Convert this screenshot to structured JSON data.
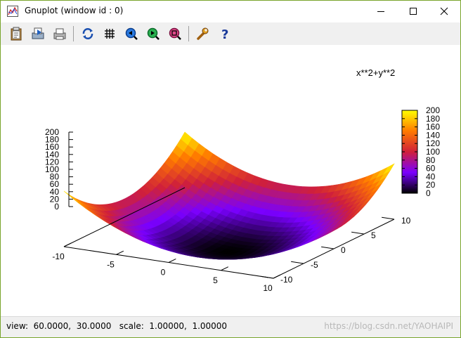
{
  "window": {
    "title": "Gnuplot (window id : 0)"
  },
  "toolbar": {
    "buttons": [
      {
        "name": "copy-clipboard-icon"
      },
      {
        "name": "print-setup-icon"
      },
      {
        "name": "print-icon"
      },
      {
        "name": "replot-icon"
      },
      {
        "name": "grid-icon"
      },
      {
        "name": "zoom-previous-icon"
      },
      {
        "name": "zoom-next-icon"
      },
      {
        "name": "unzoom-icon"
      },
      {
        "name": "options-wrench-icon"
      },
      {
        "name": "help-icon"
      }
    ]
  },
  "plot": {
    "title": "x**2+y**2",
    "zlabels": [
      "200",
      "180",
      "160",
      "140",
      "120",
      "100",
      "80",
      "60",
      "40",
      "20",
      "0"
    ],
    "cblabels": [
      "200",
      "180",
      "160",
      "140",
      "120",
      "100",
      "80",
      "60",
      "40",
      "20",
      "0"
    ],
    "xlabels": [
      "-10",
      "-5",
      "0",
      "5",
      "10"
    ],
    "ylabels": [
      "-10",
      "-5",
      "0",
      "5",
      "10"
    ]
  },
  "chart_data": {
    "type": "surface",
    "title": "x**2+y**2",
    "function": "x**2+y**2",
    "xlim": [
      -10,
      10
    ],
    "ylim": [
      -10,
      10
    ],
    "zlim": [
      0,
      200
    ],
    "cbrange": [
      0,
      200
    ],
    "view": [
      60,
      30
    ],
    "x_ticks": [
      -10,
      -5,
      0,
      5,
      10
    ],
    "y_ticks": [
      -10,
      -5,
      0,
      5,
      10
    ],
    "z_ticks": [
      0,
      20,
      40,
      60,
      80,
      100,
      120,
      140,
      160,
      180,
      200
    ],
    "colorbox": true,
    "palette": [
      "#000000",
      "#7a00ff",
      "#d0203a",
      "#ff7a00",
      "#ffff00"
    ]
  },
  "status": {
    "text": "view:  60.0000,  30.0000   scale:  1.00000,  1.00000",
    "watermark": "https://blog.csdn.net/YAOHAIPI"
  },
  "colors": {
    "window_border": "#79a52c",
    "toolbar_bg": "#f0f0f0"
  }
}
